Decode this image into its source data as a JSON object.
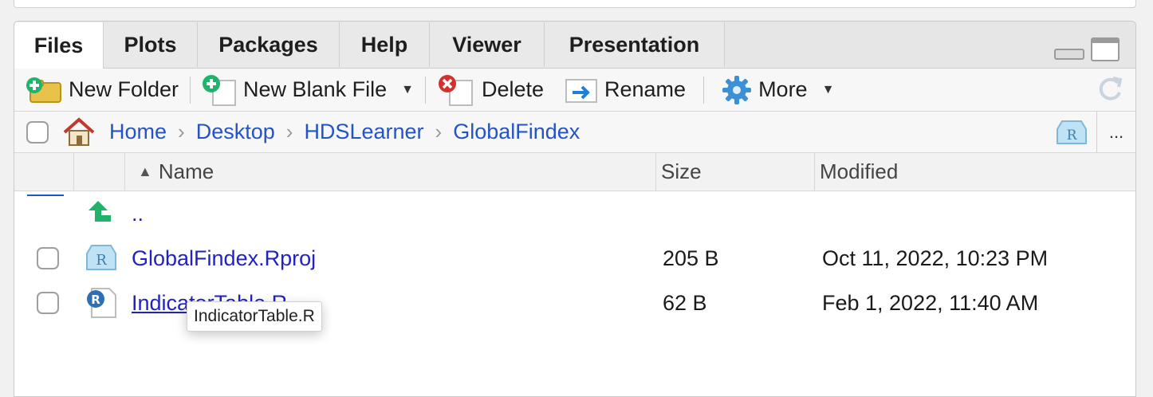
{
  "tabs": [
    {
      "label": "Files"
    },
    {
      "label": "Plots"
    },
    {
      "label": "Packages"
    },
    {
      "label": "Help"
    },
    {
      "label": "Viewer"
    },
    {
      "label": "Presentation"
    }
  ],
  "toolbar": {
    "new_folder": "New Folder",
    "new_blank_file": "New Blank File",
    "delete": "Delete",
    "rename": "Rename",
    "more": "More"
  },
  "breadcrumb": [
    "Home",
    "Desktop",
    "HDSLearner",
    "GlobalFindex"
  ],
  "overflow_label": "...",
  "columns": {
    "name": "Name",
    "size": "Size",
    "modified": "Modified"
  },
  "parent_link": "..",
  "files": [
    {
      "name": "GlobalFindex.Rproj",
      "size": "205 B",
      "modified": "Oct 11, 2022, 10:23 PM"
    },
    {
      "name": "IndicatorTable.R",
      "size": "62 B",
      "modified": "Feb 1, 2022, 11:40 AM"
    }
  ],
  "tooltip": "IndicatorTable.R",
  "colors": {
    "link": "#2222c2",
    "breadcrumb": "#2354c7",
    "accent_green": "#1fb36b"
  }
}
